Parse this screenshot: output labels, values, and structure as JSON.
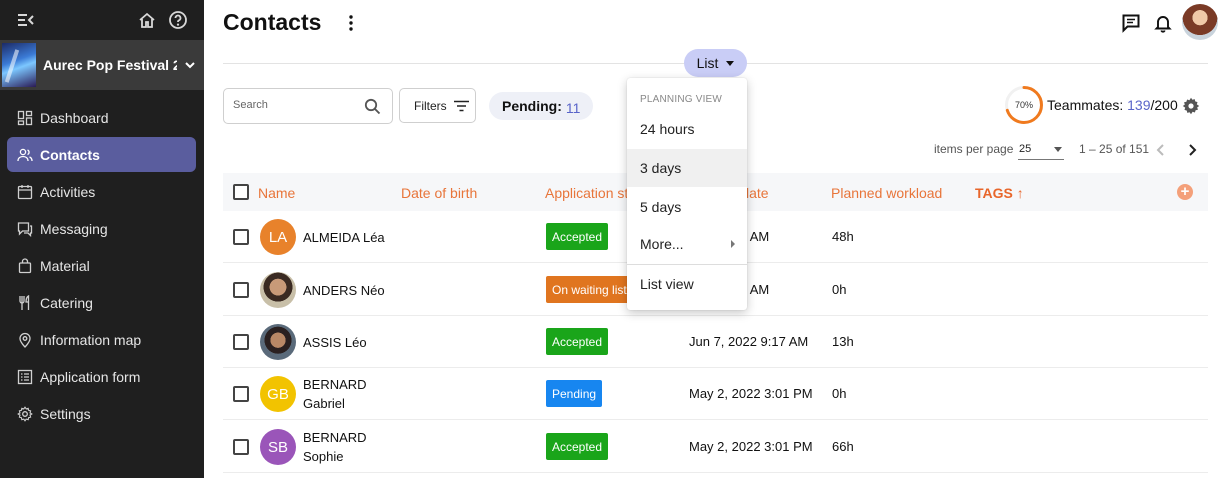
{
  "sidebar": {
    "event_name": "Aurec Pop Festival 20…",
    "items": [
      {
        "label": "Dashboard",
        "icon": "dashboard-icon"
      },
      {
        "label": "Contacts",
        "icon": "contacts-icon",
        "active": true
      },
      {
        "label": "Activities",
        "icon": "calendar-icon"
      },
      {
        "label": "Messaging",
        "icon": "messaging-icon"
      },
      {
        "label": "Material",
        "icon": "bag-icon"
      },
      {
        "label": "Catering",
        "icon": "fork-knife-icon"
      },
      {
        "label": "Information map",
        "icon": "map-pin-icon"
      },
      {
        "label": "Application form",
        "icon": "form-icon"
      },
      {
        "label": "Settings",
        "icon": "gear-icon"
      }
    ]
  },
  "header": {
    "title": "Contacts",
    "view_button": "List"
  },
  "toolbar": {
    "search_placeholder": "Search",
    "filters_label": "Filters",
    "pending_label": "Pending:",
    "pending_count": "11",
    "progress_label": "70%",
    "progress_fraction": 0.7,
    "teammates_label": "Teammates:",
    "teammates_count": "139",
    "teammates_total": "/200"
  },
  "pagination": {
    "items_per_page_label": "items per page",
    "items_per_page": "25",
    "range": "1 – 25 of 151"
  },
  "table": {
    "columns": [
      "Name",
      "Date of birth",
      "Application st",
      "late",
      "Planned workload",
      "TAGS ↑"
    ],
    "rows": [
      {
        "initials": "LA",
        "avatar_color": "#e8822b",
        "name_line1": "ALMEIDA Léa",
        "name_line2": "",
        "status": "Accepted",
        "status_color": "#1aa51a",
        "date": "2022 9:17 AM",
        "workload": "48h"
      },
      {
        "initials": "",
        "avatar_color": "",
        "name_line1": "ANDERS Néo",
        "name_line2": "",
        "status": "On waiting list",
        "status_color": "#e0751f",
        "date": "2022 9:17 AM",
        "workload": "0h"
      },
      {
        "initials": "",
        "avatar_color": "",
        "name_line1": "ASSIS Léo",
        "name_line2": "",
        "status": "Accepted",
        "status_color": "#1aa51a",
        "date": "Jun 7, 2022 9:17 AM",
        "workload": "13h"
      },
      {
        "initials": "GB",
        "avatar_color": "#f2c300",
        "name_line1": "BERNARD",
        "name_line2": "Gabriel",
        "status": "Pending",
        "status_color": "#1786f0",
        "date": "May 2, 2022 3:01 PM",
        "workload": "0h"
      },
      {
        "initials": "SB",
        "avatar_color": "#9a55b9",
        "name_line1": "BERNARD",
        "name_line2": "Sophie",
        "status": "Accepted",
        "status_color": "#1aa51a",
        "date": "May 2, 2022 3:01 PM",
        "workload": "66h"
      }
    ]
  },
  "menu": {
    "heading": "PLANNING VIEW",
    "items": [
      "24 hours",
      "3 days",
      "5 days",
      "More...",
      "List view"
    ]
  }
}
